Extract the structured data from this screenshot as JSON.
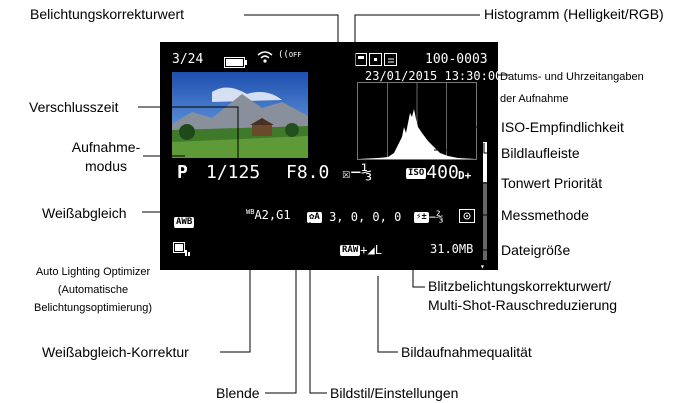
{
  "screen": {
    "frame": "3/24",
    "file_number": "100-0003",
    "datetime": "23/01/2015 13:30:00",
    "shooting_mode": "P",
    "shutter": "1/125",
    "aperture": "F8.0",
    "exposure_comp": "−⅓",
    "iso_label": "ISO",
    "iso": "400",
    "tone_priority": "D+",
    "wb": "AWB",
    "wb_correction": "A2,G1",
    "wb_correction_prefix": "WB",
    "picture_style_badge": "A",
    "picture_style": "3, 0, 0, 0",
    "flash_comp": "−⅔",
    "raw": "RAW",
    "quality": "+◢L",
    "filesize": "31.0MB",
    "wifi_off": "OFF"
  },
  "labels": {
    "exposure_comp": "Belichtungskorrekturwert",
    "histogram": "Histogramm (Helligkeit/RGB)",
    "datetime_line1": "Datums- und Uhrzeitangaben",
    "datetime_line2": "der Aufnahme",
    "shutter": "Verschlusszeit",
    "iso": "ISO-Empfindlichkeit",
    "mode_line1": "Aufnahme-",
    "mode_line2": "modus",
    "scrollbar": "Bildlaufleiste",
    "tone_priority": "Tonwert Priorität",
    "wb": "Weißabgleich",
    "metering": "Messmethode",
    "filesize": "Dateigröße",
    "alo_line1": "Auto Lighting Optimizer",
    "alo_line2": "(Automatische",
    "alo_line3": "Belichtungsoptimierung)",
    "flash_line1": "Blitzbelichtungskorrekturwert/",
    "flash_line2": "Multi-Shot-Rauschreduzierung",
    "wb_correction": "Weißabgleich-Korrektur",
    "quality": "Bildaufnahmequalität",
    "aperture": "Blende",
    "picture_style": "Bildstil/Einstellungen"
  },
  "colors": {
    "screen_bg": "#000000",
    "histogram": "#ffffff",
    "leader": "#000000"
  }
}
